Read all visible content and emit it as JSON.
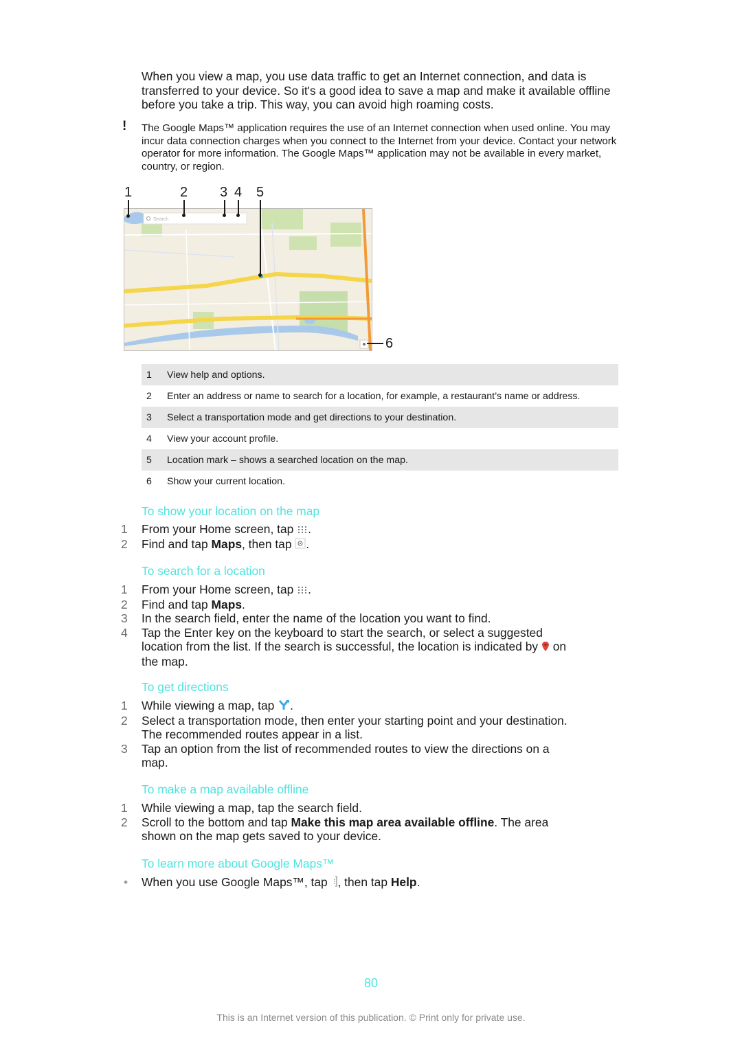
{
  "intro_paragraph": "When you view a map, you use data traffic to get an Internet connection, and data is transferred to your device. So it's a good idea to save a map and make it available offline before you take a trip. This way, you can avoid high roaming costs.",
  "note": {
    "icon": "exclamation-icon",
    "text": "The Google Maps™ application requires the use of an Internet connection when used online. You may incur data connection charges when you connect to the Internet from your device. Contact your network operator for more information. The Google Maps™ application may not be available in every market, country, or region."
  },
  "figure": {
    "search_placeholder": "Search",
    "callouts": [
      "1",
      "2",
      "3",
      "4",
      "5",
      "6"
    ]
  },
  "legend": [
    {
      "num": "1",
      "text": "View help and options."
    },
    {
      "num": "2",
      "text": "Enter an address or name to search for a location, for example, a restaurant’s name or address."
    },
    {
      "num": "3",
      "text": "Select a transportation mode and get directions to your destination."
    },
    {
      "num": "4",
      "text": "View your account profile."
    },
    {
      "num": "5",
      "text": "Location mark – shows a searched location on the map."
    },
    {
      "num": "6",
      "text": "Show your current location."
    }
  ],
  "sections": {
    "show_location": {
      "title": "To show your location on the map",
      "steps": [
        {
          "num": "1",
          "pre": "From your Home screen, tap ",
          "icon": "apps-grid-icon",
          "post": "."
        },
        {
          "num": "2",
          "pre": "Find and tap ",
          "bold": "Maps",
          "mid": ", then tap ",
          "icon": "my-location-icon",
          "post": "."
        }
      ]
    },
    "search_location": {
      "title": "To search for a location",
      "steps": [
        {
          "num": "1",
          "pre": "From your Home screen, tap ",
          "icon": "apps-grid-icon",
          "post": "."
        },
        {
          "num": "2",
          "pre": "Find and tap ",
          "bold": "Maps",
          "post": "."
        },
        {
          "num": "3",
          "text": "In the search field, enter the name of the location you want to find."
        },
        {
          "num": "4",
          "pre": "Tap the Enter key on the keyboard to start the search, or select a suggested location from the list. If the search is successful, the location is indicated by ",
          "icon": "location-pin-icon",
          "post": " on the map."
        }
      ]
    },
    "directions": {
      "title": "To get directions",
      "steps": [
        {
          "num": "1",
          "pre": "While viewing a map, tap ",
          "icon": "directions-icon",
          "post": "."
        },
        {
          "num": "2",
          "text": "Select a transportation mode, then enter your starting point and your destination. The recommended routes appear in a list."
        },
        {
          "num": "3",
          "text": "Tap an option from the list of recommended routes to view the directions on a map."
        }
      ]
    },
    "offline": {
      "title": "To make a map available offline",
      "steps": [
        {
          "num": "1",
          "text": "While viewing a map, tap the search field."
        },
        {
          "num": "2",
          "pre": "Scroll to the bottom and tap ",
          "bold": "Make this map area available offline",
          "post": ". The area shown on the map gets saved to your device."
        }
      ]
    },
    "learn_more": {
      "title": "To learn more about Google Maps™",
      "steps": [
        {
          "num": "•",
          "pre": "When you use Google Maps™, tap ",
          "icon": "menu-icon",
          "mid": ", then tap ",
          "bold": "Help",
          "post": "."
        }
      ]
    }
  },
  "page_number": "80",
  "footer": "This is an Internet version of this publication. © Print only for private use.",
  "colors": {
    "heading": "#4fe3df",
    "shaded_row": "#e6e6e6",
    "text": "#1a1a1a"
  }
}
